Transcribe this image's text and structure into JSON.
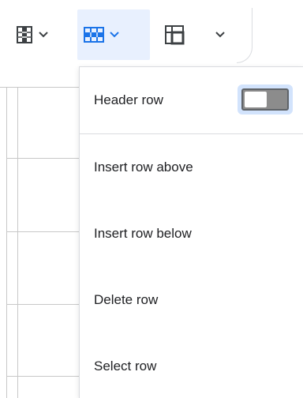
{
  "toolbar": {
    "buttons": [
      {
        "icon": "table-column-icon",
        "active": false
      },
      {
        "icon": "table-row-icon",
        "active": true
      },
      {
        "icon": "table-cell-icon",
        "active": false
      }
    ]
  },
  "menu": {
    "items": [
      {
        "label": "Header row",
        "has_toggle": true,
        "toggle_on": false
      },
      {
        "label": "Insert row above"
      },
      {
        "label": "Insert row below"
      },
      {
        "label": "Delete row"
      },
      {
        "label": "Select row"
      }
    ]
  },
  "colors": {
    "accent": "#1a73e8",
    "active_bg": "#e8f0fe",
    "divider": "#dadce0"
  }
}
